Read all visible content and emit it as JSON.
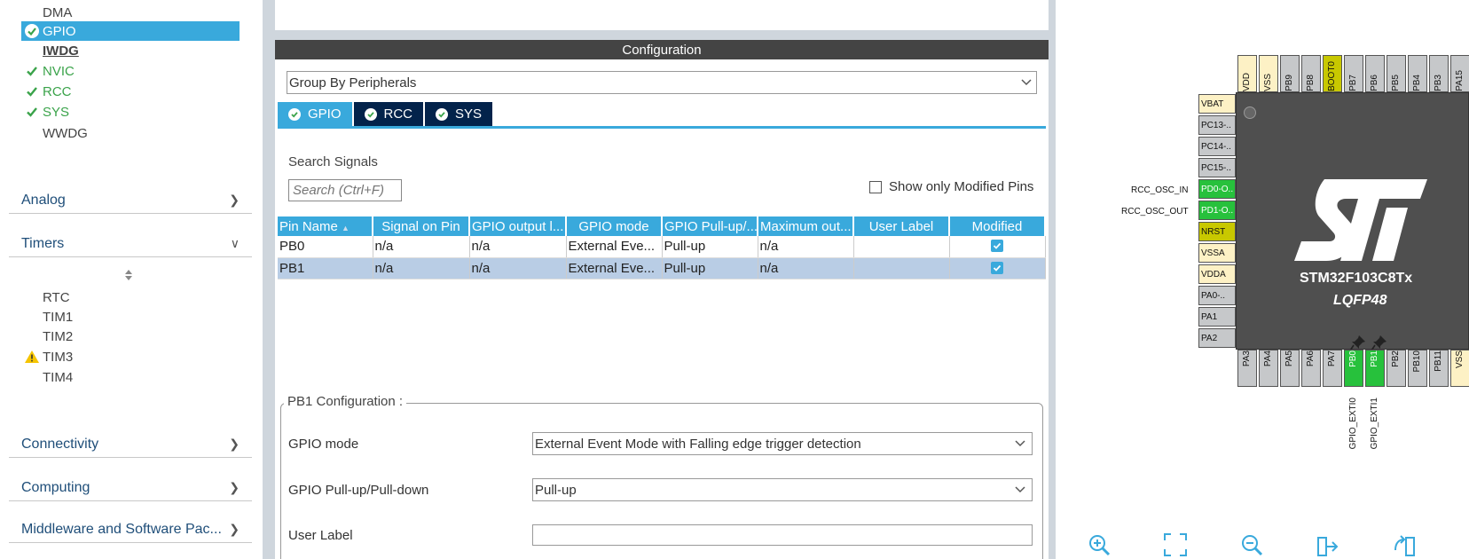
{
  "sidebar": {
    "items": [
      {
        "label": "DMA",
        "state": "none"
      },
      {
        "label": "GPIO",
        "state": "selected"
      },
      {
        "label": "IWDG",
        "state": "bold"
      },
      {
        "label": "NVIC",
        "state": "ok"
      },
      {
        "label": "RCC",
        "state": "ok"
      },
      {
        "label": "SYS",
        "state": "ok"
      },
      {
        "label": "WWDG",
        "state": "none"
      }
    ],
    "categories": {
      "analog": "Analog",
      "timers": "Timers",
      "connectivity": "Connectivity",
      "computing": "Computing",
      "middleware": "Middleware and Software Pac..."
    },
    "timers": [
      {
        "label": "RTC",
        "state": "none"
      },
      {
        "label": "TIM1",
        "state": "none"
      },
      {
        "label": "TIM2",
        "state": "none"
      },
      {
        "label": "TIM3",
        "state": "warning"
      },
      {
        "label": "TIM4",
        "state": "none"
      }
    ]
  },
  "config": {
    "title": "Configuration",
    "group_by": "Group By Peripherals",
    "tabs": [
      "GPIO",
      "RCC",
      "SYS"
    ],
    "search_label": "Search Signals",
    "search_placeholder": "Search (Ctrl+F)",
    "show_modified_label": "Show only Modified Pins",
    "table": {
      "headers": [
        "Pin Name",
        "Signal on Pin",
        "GPIO output l...",
        "GPIO mode",
        "GPIO Pull-up/...",
        "Maximum out...",
        "User Label",
        "Modified"
      ],
      "rows": [
        {
          "pin": "PB0",
          "signal": "n/a",
          "output": "n/a",
          "mode": "External Eve...",
          "pull": "Pull-up",
          "max": "n/a",
          "label": "",
          "modified": true
        },
        {
          "pin": "PB1",
          "signal": "n/a",
          "output": "n/a",
          "mode": "External Eve...",
          "pull": "Pull-up",
          "max": "n/a",
          "label": "",
          "modified": true
        }
      ]
    },
    "pin_config": {
      "title": "PB1 Configuration :",
      "gpio_mode_label": "GPIO mode",
      "gpio_mode_value": "External Event Mode with Falling edge trigger detection",
      "pull_label": "GPIO Pull-up/Pull-down",
      "pull_value": "Pull-up",
      "user_label_label": "User Label",
      "user_label_value": ""
    }
  },
  "chip": {
    "name": "STM32F103C8Tx",
    "package": "LQFP48",
    "top_pins": [
      "VDD",
      "VSS",
      "PB9",
      "PB8",
      "BOOT0",
      "PB7",
      "PB6",
      "PB5",
      "PB4",
      "PB3",
      "PA15"
    ],
    "left_pins": [
      "VBAT",
      "PC13-..",
      "PC14-..",
      "PC15-..",
      "PD0-O..",
      "PD1-O..",
      "NRST",
      "VSSA",
      "VDDA",
      "PA0-..",
      "PA1",
      "PA2"
    ],
    "bottom_pins": [
      "PA3",
      "PA4",
      "PA5",
      "PA6",
      "PA7",
      "PB0",
      "PB1",
      "PB2",
      "PB10",
      "PB11",
      "VSS"
    ],
    "left_signals": {
      "pd0": "RCC_OSC_IN",
      "pd1": "RCC_OSC_OUT"
    },
    "bottom_signals": {
      "pb0": "GPIO_EXTI0",
      "pb1": "GPIO_EXTI1"
    }
  },
  "colors": {
    "accent": "#39a9dc",
    "dark_tab": "#03234b",
    "ok_green": "#3aa34a",
    "pin_green": "#27c13c",
    "pin_yellow": "#fdf1c5",
    "pin_olive": "#c8c800"
  }
}
